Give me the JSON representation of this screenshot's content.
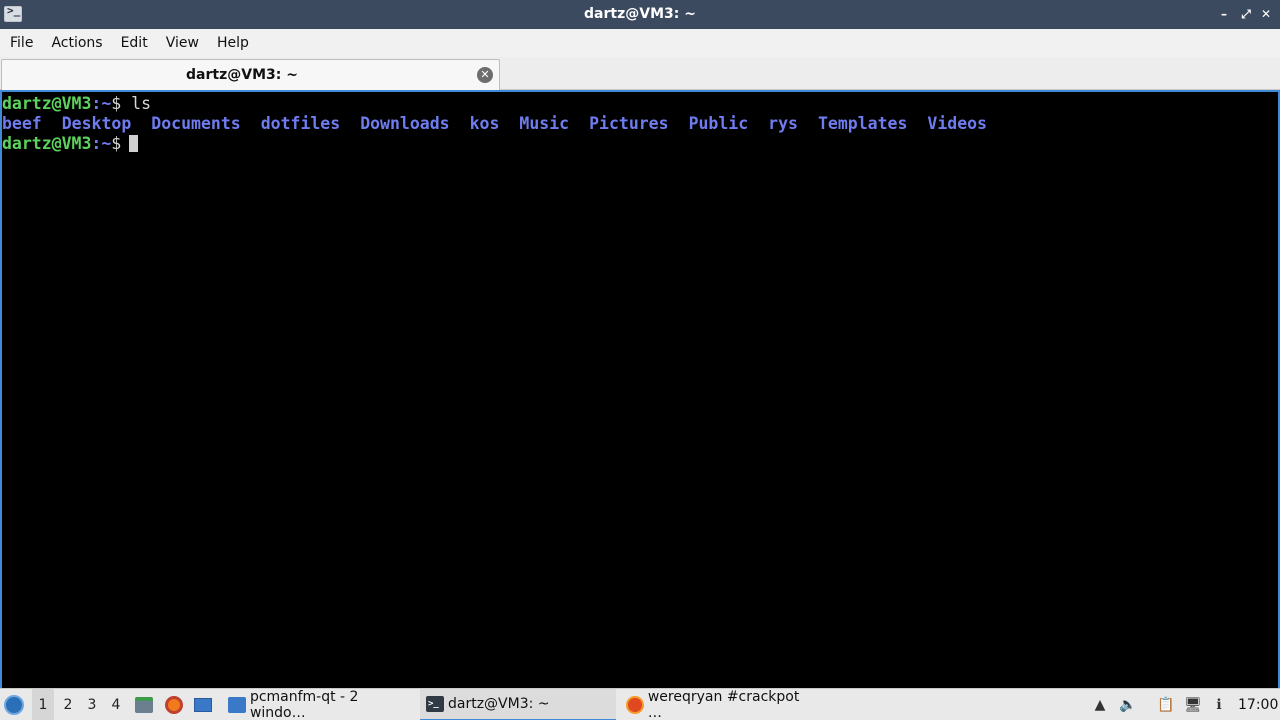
{
  "window": {
    "title": "dartz@VM3: ~",
    "app_icon_glyph": ">_",
    "minimize_glyph": "–",
    "maximize_glyph": "⤢",
    "close_glyph": "✕"
  },
  "menubar": {
    "items": [
      "File",
      "Actions",
      "Edit",
      "View",
      "Help"
    ]
  },
  "tabs": [
    {
      "label": "dartz@VM3: ~",
      "close_glyph": "✕"
    }
  ],
  "terminal": {
    "line1": {
      "user": "dartz@VM3",
      "path": ":~",
      "symbol": "$",
      "command": " ls"
    },
    "ls_output": [
      "beef",
      "Desktop",
      "Documents",
      "dotfiles",
      "Downloads",
      "kos",
      "Music",
      "Pictures",
      "Public",
      "rys",
      "Templates",
      "Videos"
    ],
    "line3": {
      "user": "dartz@VM3",
      "path": ":~",
      "symbol": "$"
    },
    "colors": {
      "user": "#5dd35d",
      "dir": "#6f7cf0",
      "background": "#000000"
    }
  },
  "taskbar": {
    "workspaces": [
      "1",
      "2",
      "3",
      "4"
    ],
    "active_workspace": "1",
    "quicklaunch": [
      "file-manager-icon",
      "firefox-icon",
      "show-desktop-icon"
    ],
    "tasks": [
      {
        "label": "pcmanfm-qt - 2 windo…",
        "icon": "folder-icon"
      },
      {
        "label": "dartz@VM3: ~",
        "icon": "terminal-icon"
      },
      {
        "label": "wereqryan #crackpot …",
        "icon": "firefox-icon"
      }
    ],
    "tray": [
      "tray-expand-icon",
      "volume-icon",
      "clipboard-icon",
      "network-icon",
      "update-icon"
    ],
    "clock": "17:00"
  }
}
